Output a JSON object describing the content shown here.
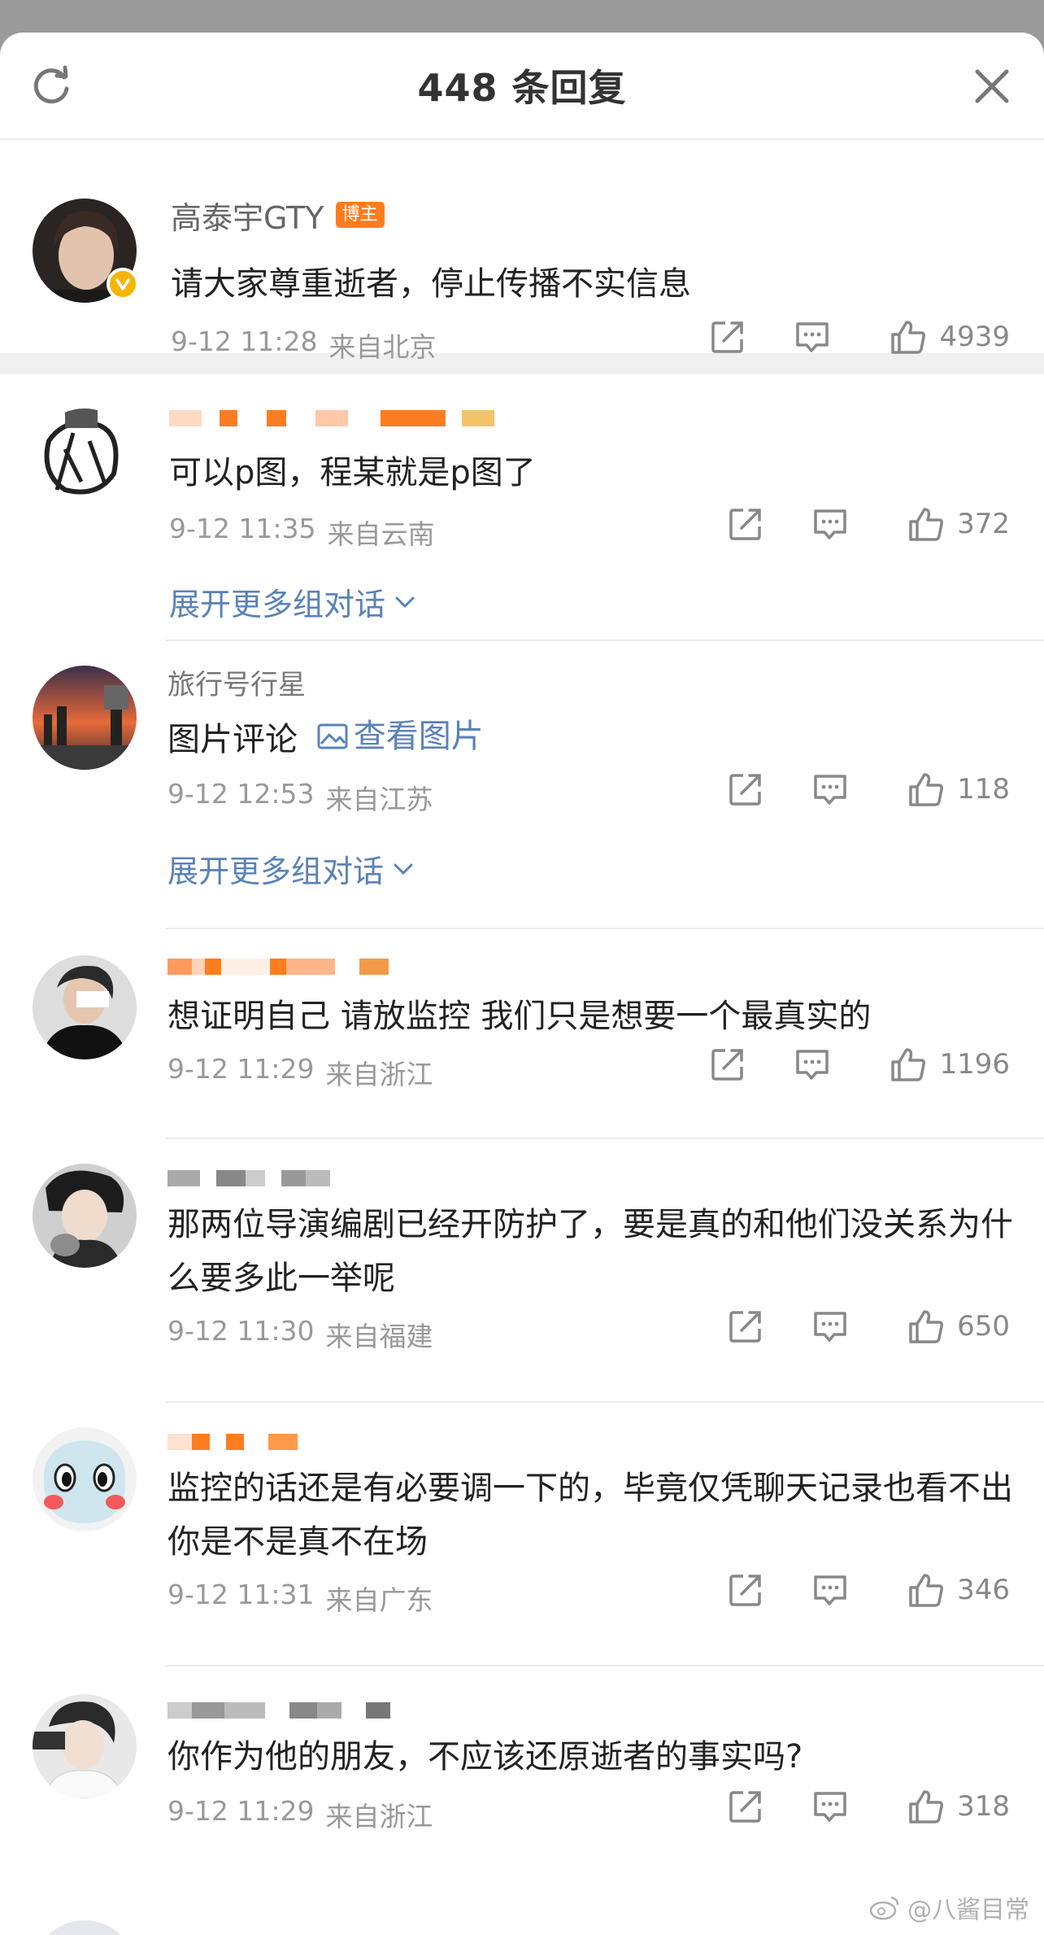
{
  "header": {
    "title": "448 条回复"
  },
  "host": {
    "name": "高泰宇GTY",
    "badge": "博主",
    "text": "请大家尊重逝者，停止传播不实信息",
    "time": "9-12 11:28",
    "location": "来自北京",
    "likes": "4939"
  },
  "replies": [
    {
      "name": "",
      "text": "可以p图，程某就是p图了",
      "time": "9-12 11:35",
      "location": "来自云南",
      "likes": "372",
      "expand": "展开更多组对话"
    },
    {
      "name": "旅行号行星",
      "text": "图片评论",
      "link": "查看图片",
      "time": "9-12 12:53",
      "location": "来自江苏",
      "likes": "118",
      "expand": "展开更多组对话"
    },
    {
      "name": "",
      "text": "想证明自己 请放监控 我们只是想要一个最真实的",
      "time": "9-12 11:29",
      "location": "来自浙江",
      "likes": "1196"
    },
    {
      "name": "",
      "text": "那两位导演编剧已经开防护了，要是真的和他们没关系为什么要多此一举呢",
      "time": "9-12 11:30",
      "location": "来自福建",
      "likes": "650"
    },
    {
      "name": "",
      "text": "监控的话还是有必要调一下的，毕竟仅凭聊天记录也看不出你是不是真不在场",
      "time": "9-12 11:31",
      "location": "来自广东",
      "likes": "346"
    },
    {
      "name": "",
      "text": "你作为他的朋友，不应该还原逝者的事实吗?",
      "time": "9-12 11:29",
      "location": "来自浙江",
      "likes": "318"
    }
  ],
  "watermark": "@八酱目常",
  "colors": {
    "link": "#5a82b8",
    "badge": "#ff7d1e",
    "meta": "#999999"
  }
}
